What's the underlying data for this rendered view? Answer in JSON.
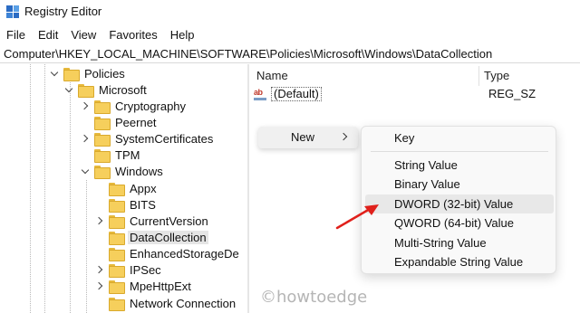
{
  "window": {
    "title": "Registry Editor"
  },
  "menubar": {
    "items": [
      "File",
      "Edit",
      "View",
      "Favorites",
      "Help"
    ]
  },
  "address": {
    "path": "Computer\\HKEY_LOCAL_MACHINE\\SOFTWARE\\Policies\\Microsoft\\Windows\\DataCollection"
  },
  "tree": {
    "items": [
      {
        "label": "Policies",
        "expander": "down"
      },
      {
        "label": "Microsoft",
        "expander": "down"
      },
      {
        "label": "Cryptography",
        "expander": "right"
      },
      {
        "label": "Peernet",
        "expander": "none"
      },
      {
        "label": "SystemCertificates",
        "expander": "right"
      },
      {
        "label": "TPM",
        "expander": "none"
      },
      {
        "label": "Windows",
        "expander": "down"
      },
      {
        "label": "Appx",
        "expander": "none"
      },
      {
        "label": "BITS",
        "expander": "none"
      },
      {
        "label": "CurrentVersion",
        "expander": "right"
      },
      {
        "label": "DataCollection",
        "expander": "none",
        "selected": true
      },
      {
        "label": "EnhancedStorageDe",
        "expander": "none"
      },
      {
        "label": "IPSec",
        "expander": "right"
      },
      {
        "label": "MpeHttpExt",
        "expander": "right"
      },
      {
        "label": "Network Connection",
        "expander": "none"
      }
    ]
  },
  "values_pane": {
    "columns": {
      "name": "Name",
      "type": "Type"
    },
    "rows": [
      {
        "name": "(Default)",
        "type": "REG_SZ",
        "icon": "string-value-icon"
      }
    ]
  },
  "context_menu": {
    "new_label": "New",
    "submenu": [
      {
        "label": "Key",
        "group": 1
      },
      {
        "label": "String Value",
        "group": 2
      },
      {
        "label": "Binary Value",
        "group": 2
      },
      {
        "label": "DWORD (32-bit) Value",
        "group": 2,
        "highlighted": true
      },
      {
        "label": "QWORD (64-bit) Value",
        "group": 2
      },
      {
        "label": "Multi-String Value",
        "group": 2
      },
      {
        "label": "Expandable String Value",
        "group": 2
      }
    ]
  },
  "watermark": "©howtoedge",
  "colors": {
    "folder": "#f6cf5c",
    "annotation_arrow": "#e0201b",
    "highlight": "#e8e8e8"
  }
}
